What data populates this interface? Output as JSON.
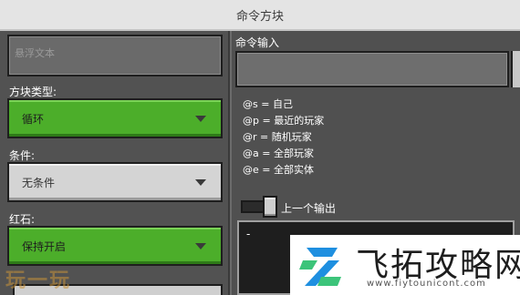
{
  "window": {
    "title": "命令方块"
  },
  "left_panel": {
    "hover_text": {
      "placeholder": "悬浮文本"
    },
    "block_type": {
      "label": "方块类型:",
      "value": "循环"
    },
    "condition": {
      "label": "条件:",
      "value": "无条件"
    },
    "redstone": {
      "label": "红石:",
      "value": "保持开启"
    }
  },
  "right_panel": {
    "command_input": {
      "label": "命令输入",
      "value": ""
    },
    "selectors": [
      "@s = 自己",
      "@p = 最近的玩家",
      "@r = 随机玩家",
      "@a = 全部玩家",
      "@e = 全部实体"
    ],
    "previous_output": {
      "label": "上一个输出",
      "value": "-"
    }
  },
  "watermarks": {
    "left": "玩一玩",
    "site_name": "飞拓攻略网",
    "site_url": "www.fiytounicont.com"
  },
  "colors": {
    "green": "#4cae2a",
    "titlebar": "#e4e4e4",
    "panel": "#525252",
    "logo_blue": "#1e8fe0",
    "logo_green": "#3cc47a"
  }
}
